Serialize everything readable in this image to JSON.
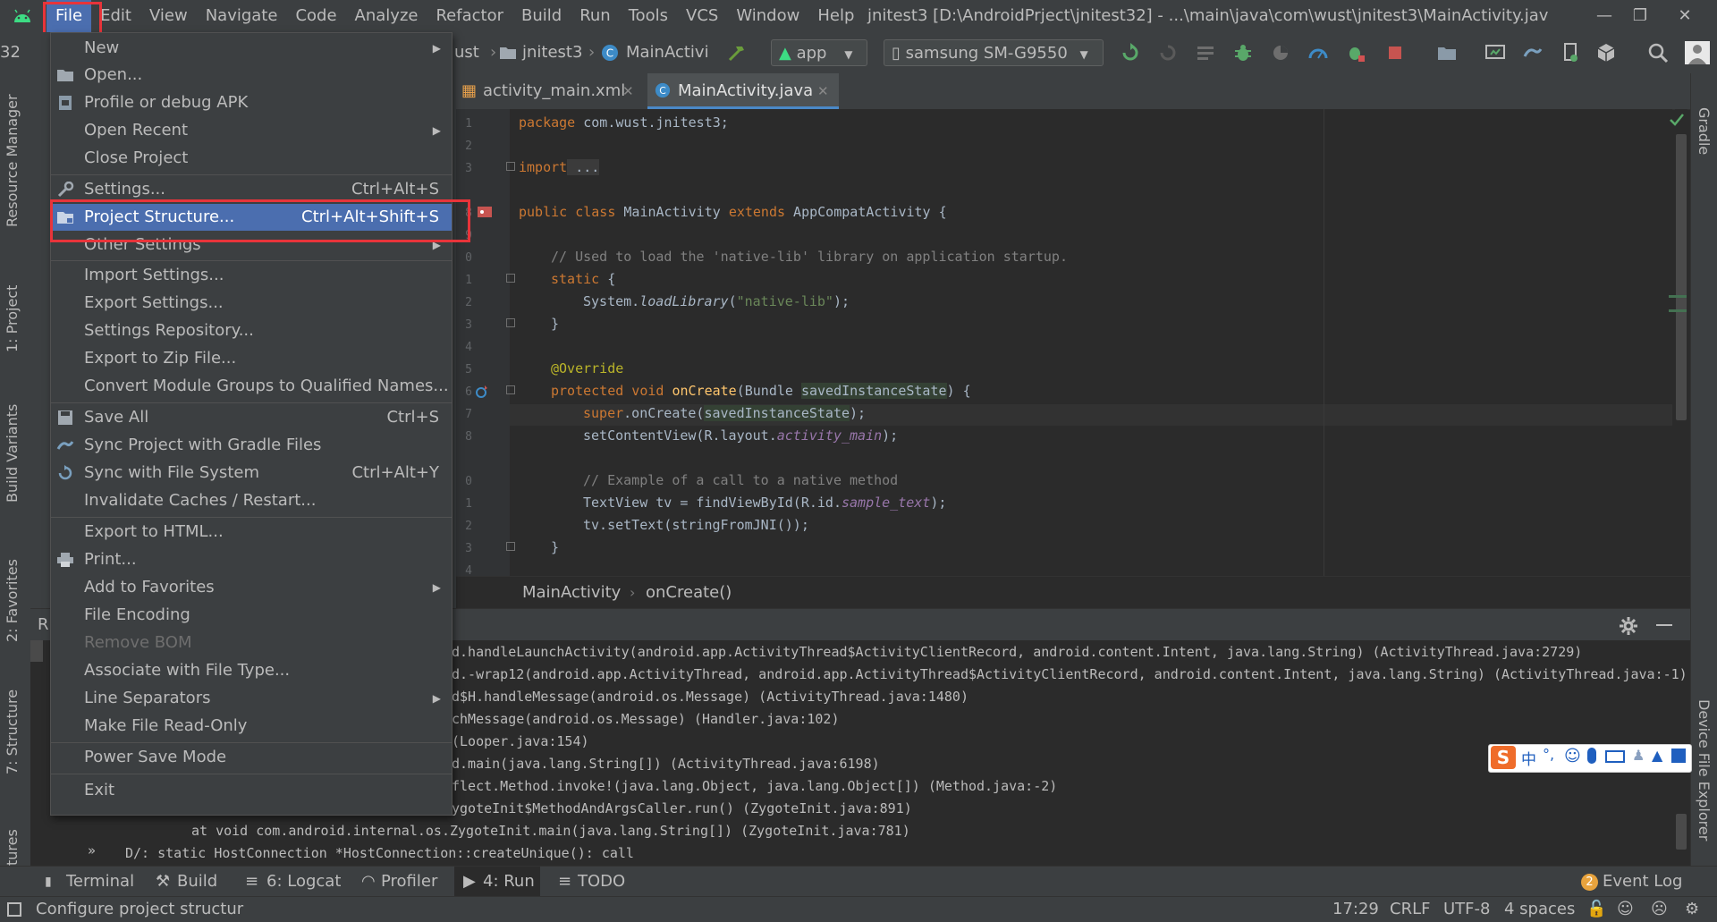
{
  "menubar": {
    "items": [
      "File",
      "Edit",
      "View",
      "Navigate",
      "Code",
      "Analyze",
      "Refactor",
      "Build",
      "Run",
      "Tools",
      "VCS",
      "Window",
      "Help"
    ],
    "window_title": "jnitest3 [D:\\AndroidPrject\\jnitest32] - ...\\main\\java\\com\\wust\\jnitest3\\MainActivity.jav"
  },
  "toolbar": {
    "project_fragment": "32",
    "crumb_ust": "ust",
    "crumb_project": "jnitest3",
    "crumb_class": "MainActivi",
    "run_config": "app",
    "device": "samsung SM-G9550"
  },
  "left_tools": [
    "Resource Manager",
    "1: Project",
    "Build Variants",
    "2: Favorites",
    "7: Structure",
    "tures"
  ],
  "right_tools": [
    "Gradle",
    "Device File Explorer"
  ],
  "editor": {
    "tabs": [
      "activity_main.xml",
      "MainActivity.java"
    ],
    "active_tab": "MainActivity.java",
    "line_numbers": [
      "1",
      "2",
      "3",
      "8",
      "9",
      "0",
      "1",
      "2",
      "3",
      "4",
      "5",
      "6",
      "7",
      "8",
      "9",
      "0",
      "1",
      "2",
      "3",
      "4"
    ],
    "breadcrumb": [
      "MainActivity",
      "onCreate()"
    ],
    "code": {
      "l1_kw": "package",
      "l1_rest": " com.wust.jnitest3;",
      "l3_kw": "import",
      "l3_rest": " ...",
      "l8_kw": "public class",
      "l8_name": " MainActivity ",
      "l8_kw2": "extends",
      "l8_rest": " AppCompatActivity {",
      "l10_cm": "// Used to load the 'native-lib' library on application startup.",
      "l11_kw": "static",
      "l11_rest": " {",
      "l12_a": "System.",
      "l12_fn": "loadLibrary",
      "l12_b": "(",
      "l12_str": "\"native-lib\"",
      "l12_c": ");",
      "l13": "}",
      "l15_an": "@Override",
      "l16_kw": "protected void",
      "l16_fn": " onCreate",
      "l16_a": "(Bundle ",
      "l16_hl": "savedInstanceState",
      "l16_b": ") {",
      "l17_kw": "super",
      "l17_a": ".onCreate(",
      "l17_hl": "savedInstanceState",
      "l17_b": ");",
      "l18_a": "setContentView(R.layout.",
      "l18_fld": "activity_main",
      "l18_b": ");",
      "l20_cm": "// Example of a call to a native method",
      "l21_a": "TextView tv = findViewById(R.id.",
      "l21_fld": "sample_text",
      "l21_b": ");",
      "l22": "tv.setText(stringFromJNI());",
      "l23": "}"
    }
  },
  "run_panel": {
    "tab_fragment": "R",
    "console": [
      "d.handleLaunchActivity(android.app.ActivityThread$ActivityClientRecord, android.content.Intent, java.lang.String) (ActivityThread.java:2729)",
      "d.-wrap12(android.app.ActivityThread, android.app.ActivityThread$ActivityClientRecord, android.content.Intent, java.lang.String) (ActivityThread.java:-1)",
      "d$H.handleMessage(android.os.Message) (ActivityThread.java:1480)",
      "chMessage(android.os.Message) (Handler.java:102)",
      "(Looper.java:154)",
      "d.main(java.lang.String[]) (ActivityThread.java:6198)",
      "flect.Method.invoke!(java.lang.Object, java.lang.Object[]) (Method.java:-2)",
      "ygoteInit$MethodAndArgsCaller.run() (ZygoteInit.java:891)"
    ],
    "console_full": [
      "at void com.android.internal.os.ZygoteInit.main(java.lang.String[]) (ZygoteInit.java:781)",
      "D/: static HostConnection *HostConnection::createUnique(): call"
    ]
  },
  "bottom_tabs": [
    "Terminal",
    "Build",
    "6: Logcat",
    "Profiler",
    "4: Run",
    "TODO"
  ],
  "active_bottom_tab": "4: Run",
  "event_log": {
    "count": "2",
    "label": "Event Log"
  },
  "status": {
    "message": "Configure project structur",
    "position": "17:29",
    "line_sep": "CRLF",
    "encoding": "UTF-8",
    "indent": "4 spaces"
  },
  "ime": {
    "label": "中"
  },
  "file_menu": {
    "items": [
      {
        "label": "New",
        "submenu": true
      },
      {
        "label": "Open..."
      },
      {
        "label": "Profile or debug APK"
      },
      {
        "label": "Open Recent",
        "submenu": true
      },
      {
        "label": "Close Project"
      },
      {
        "label": "Settings...",
        "shortcut": "Ctrl+Alt+S"
      },
      {
        "label": "Project Structure...",
        "shortcut": "Ctrl+Alt+Shift+S",
        "selected": true
      },
      {
        "label": "Other Settings",
        "submenu": true
      },
      {
        "label": "Import Settings..."
      },
      {
        "label": "Export Settings..."
      },
      {
        "label": "Settings Repository..."
      },
      {
        "label": "Export to Zip File..."
      },
      {
        "label": "Convert Module Groups to Qualified Names..."
      },
      {
        "label": "Save All",
        "shortcut": "Ctrl+S"
      },
      {
        "label": "Sync Project with Gradle Files"
      },
      {
        "label": "Sync with File System",
        "shortcut": "Ctrl+Alt+Y"
      },
      {
        "label": "Invalidate Caches / Restart..."
      },
      {
        "label": "Export to HTML..."
      },
      {
        "label": "Print..."
      },
      {
        "label": "Add to Favorites",
        "submenu": true
      },
      {
        "label": "File Encoding"
      },
      {
        "label": "Remove BOM",
        "disabled": true
      },
      {
        "label": "Associate with File Type..."
      },
      {
        "label": "Line Separators",
        "submenu": true
      },
      {
        "label": "Make File Read-Only"
      },
      {
        "label": "Power Save Mode"
      },
      {
        "label": "Exit"
      }
    ]
  },
  "colors": {
    "accent": "#4b6eaf",
    "highlight_box": "#e8343a",
    "background": "#2b2b2b",
    "panel": "#3c3f41"
  }
}
